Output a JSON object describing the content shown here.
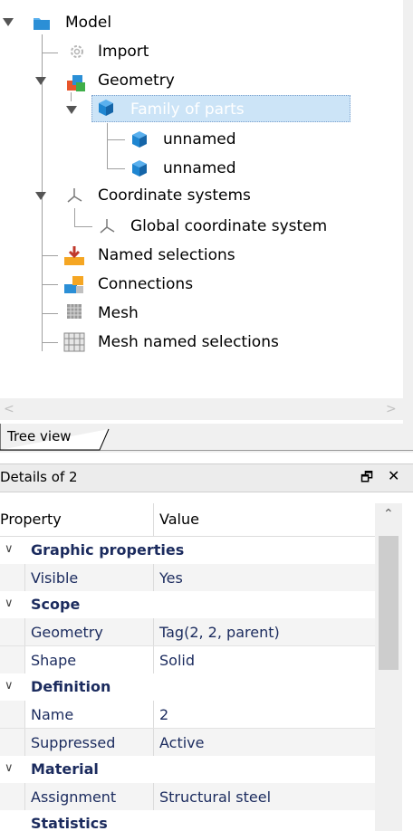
{
  "tree": {
    "nodes": [
      {
        "label": "Model",
        "icon": "folder-icon"
      },
      {
        "label": "Import",
        "icon": "gear-icon"
      },
      {
        "label": "Geometry",
        "icon": "geometry-icon"
      },
      {
        "label": "Family of parts",
        "icon": "part-cube-icon",
        "selected": true
      },
      {
        "label": "unnamed",
        "icon": "part-cube-icon"
      },
      {
        "label": "unnamed",
        "icon": "part-cube-icon"
      },
      {
        "label": "Coordinate systems",
        "icon": "axes-icon"
      },
      {
        "label": "Global coordinate system",
        "icon": "axes-icon"
      },
      {
        "label": "Named selections",
        "icon": "named-selection-icon"
      },
      {
        "label": "Connections",
        "icon": "connections-icon"
      },
      {
        "label": "Mesh",
        "icon": "mesh-icon"
      },
      {
        "label": "Mesh named selections",
        "icon": "mesh-named-selection-icon"
      }
    ]
  },
  "tab": {
    "label": "Tree view"
  },
  "details": {
    "title": "Details of 2",
    "pin_glyph": "🗗",
    "close_glyph": "✕",
    "columns": {
      "property": "Property",
      "value": "Value"
    },
    "categories": [
      {
        "name": "Graphic properties",
        "rows": [
          {
            "name": "Visible",
            "value": "Yes"
          }
        ]
      },
      {
        "name": "Scope",
        "rows": [
          {
            "name": "Geometry",
            "value": "Tag(2, 2, parent)"
          },
          {
            "name": "Shape",
            "value": "Solid"
          }
        ]
      },
      {
        "name": "Definition",
        "rows": [
          {
            "name": "Name",
            "value": "2"
          },
          {
            "name": "Suppressed",
            "value": "Active"
          }
        ]
      },
      {
        "name": "Material",
        "rows": [
          {
            "name": "Assignment",
            "value": "Structural steel"
          }
        ]
      },
      {
        "name": "Statistics",
        "rows": []
      }
    ]
  },
  "colors": {
    "selection": "#cce4f7",
    "category_text": "#1b2b5e",
    "folder": "#2b8fd6",
    "part": "#1f86d1"
  }
}
